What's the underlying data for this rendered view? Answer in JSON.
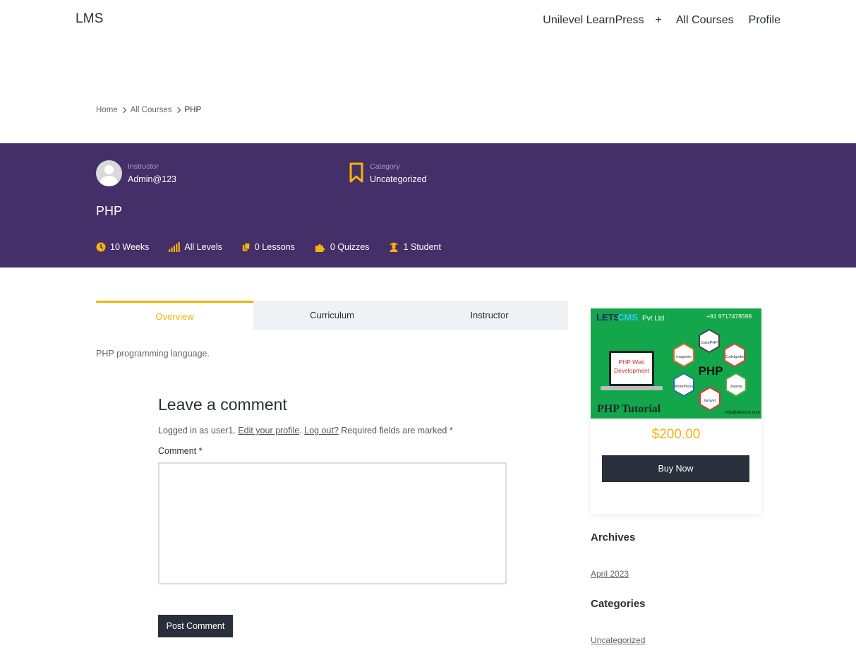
{
  "header": {
    "logo": "LMS",
    "nav": {
      "item1": "Unilevel LearnPress",
      "plus": "+",
      "item2": "All Courses",
      "item3": "Profile"
    }
  },
  "breadcrumb": {
    "home": "Home",
    "all_courses": "All Courses",
    "current": "PHP"
  },
  "hero": {
    "instructor_label": "Instructor",
    "instructor_name": "Admin@123",
    "category_label": "Category",
    "category_value": "Uncategorized",
    "title": "PHP",
    "stats": {
      "duration": "10 Weeks",
      "level": "All Levels",
      "lessons": "0 Lessons",
      "quizzes": "0 Quizzes",
      "students": "1 Student"
    },
    "accent_color": "#f5b20a",
    "background_color": "#452f68"
  },
  "tabs": {
    "overview": "Overview",
    "curriculum": "Curriculum",
    "instructor": "Instructor"
  },
  "overview_text": "PHP programming language.",
  "comment": {
    "title": "Leave a comment",
    "logged_prefix": "Logged in as user1.",
    "edit_profile": "Edit your profile",
    "logout": "Log out?",
    "required_note": "Required fields are marked *",
    "label": "Comment *",
    "textarea_value": "",
    "submit": "Post Comment"
  },
  "course_card": {
    "thumb": {
      "brand_a": "LETS",
      "brand_b": "CMS",
      "brand_suffix": "Pvt Ltd",
      "phone": "+91 9717478599",
      "screen_text_1": "PHP Web",
      "screen_text_2": "Development",
      "big_text": "PHP",
      "caption": "PHP Tutorial",
      "email": "info@letscms.com",
      "hex_labels": [
        "magento",
        "CakePHP",
        "CodeIgniter",
        "WordPress",
        "Joomla",
        "laravel"
      ]
    },
    "price": "$200.00",
    "buy_button": "Buy Now"
  },
  "sidebar": {
    "archives_title": "Archives",
    "archives_link": "April 2023",
    "categories_title": "Categories",
    "categories_link": "Uncategorized"
  }
}
